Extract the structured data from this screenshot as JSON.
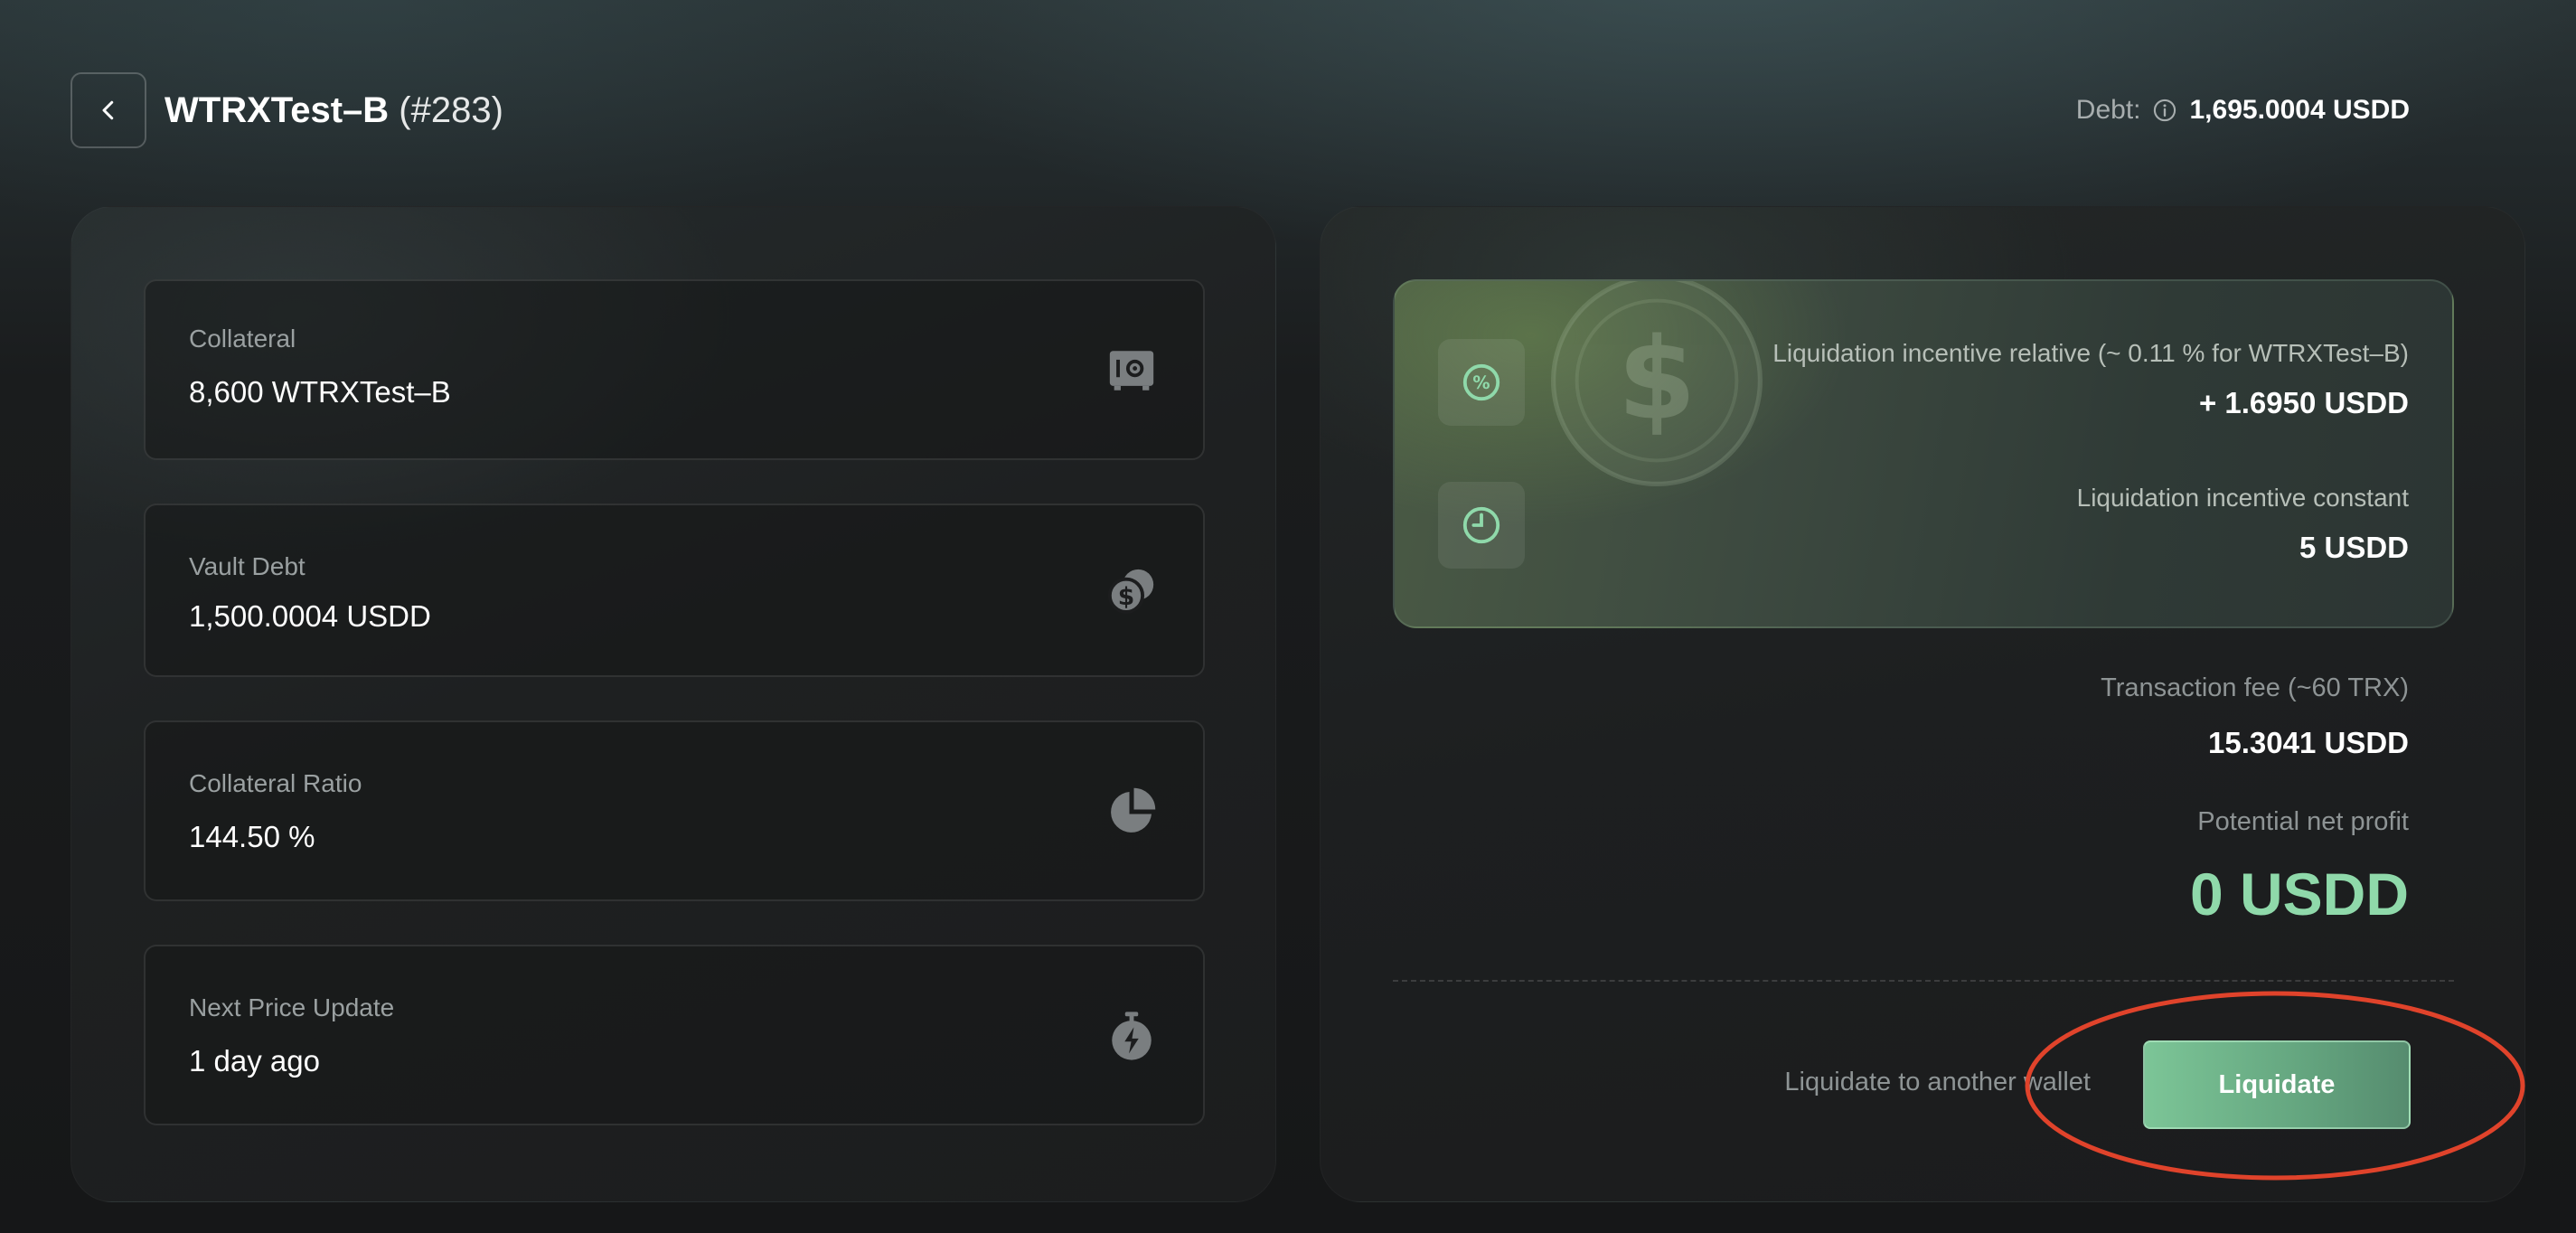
{
  "header": {
    "title": "WTRXTest–B",
    "vault_id": "(#283)",
    "debt_label": "Debt:",
    "debt_value": "1,695.0004 USDD"
  },
  "stats": [
    {
      "label": "Collateral",
      "value": "8,600 WTRXTest–B",
      "icon": "safe-icon"
    },
    {
      "label": "Vault Debt",
      "value": "1,500.0004 USDD",
      "icon": "coins-icon"
    },
    {
      "label": "Collateral Ratio",
      "value": "144.50 %",
      "icon": "pie-chart-icon"
    },
    {
      "label": "Next Price Update",
      "value": "1 day ago",
      "icon": "stopwatch-icon"
    }
  ],
  "incentive": {
    "relative_label": "Liquidation incentive relative (~ 0.11 % for WTRXTest–B)",
    "relative_value": "+ 1.6950 USDD",
    "constant_label": "Liquidation incentive constant",
    "constant_value": "5 USDD"
  },
  "fees": {
    "tx_fee_label": "Transaction fee (~60 TRX)",
    "tx_fee_value": "15.3041 USDD",
    "profit_label": "Potential net profit",
    "profit_value": "0 USDD"
  },
  "actions": {
    "alt_wallet_label": "Liquidate to another wallet",
    "liquidate_label": "Liquidate"
  },
  "colors": {
    "accent_green": "#8fd9aa",
    "button_green": "#6db58a",
    "annotation_red": "#e0432b"
  }
}
